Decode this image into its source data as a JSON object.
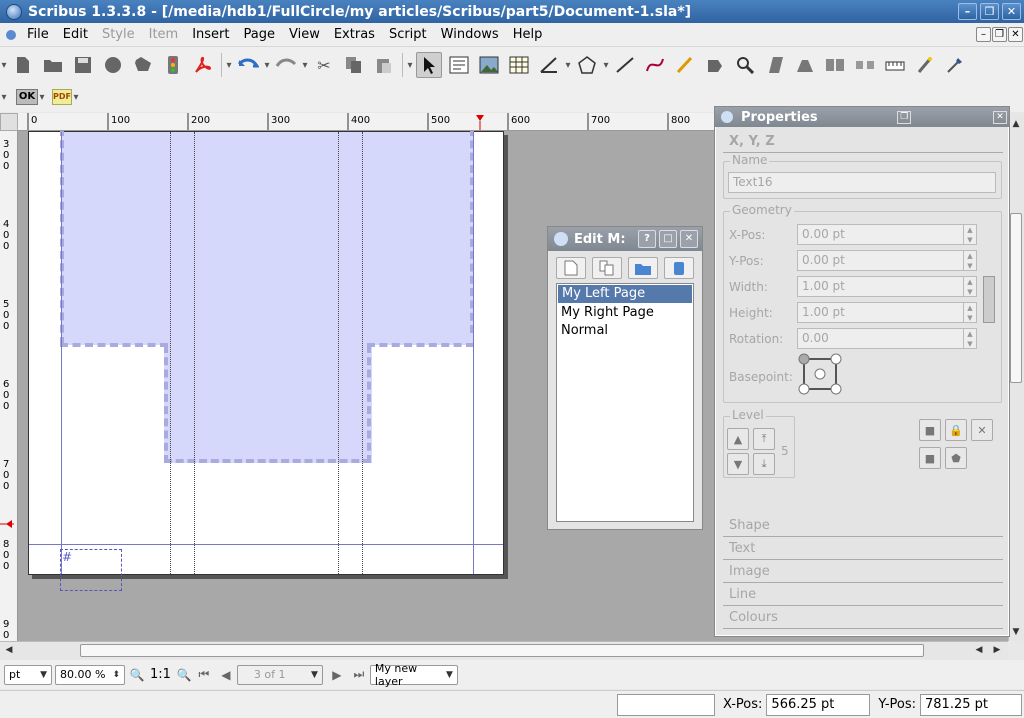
{
  "window": {
    "title": "Scribus 1.3.3.8 - [/media/hdb1/FullCircle/my articles/Scribus/part5/Document-1.sla*]",
    "btn_min": "–",
    "btn_max": "❐",
    "btn_close": "✕"
  },
  "menu": {
    "items": [
      "File",
      "Edit",
      "Style",
      "Item",
      "Insert",
      "Page",
      "View",
      "Extras",
      "Script",
      "Windows",
      "Help"
    ],
    "dim": [
      false,
      false,
      true,
      true,
      false,
      false,
      false,
      false,
      false,
      false,
      false
    ]
  },
  "toolbar2": {
    "ok_label": "OK",
    "pdf_label": "PDF"
  },
  "ruler": {
    "h_ticks": [
      "0",
      "100",
      "200",
      "300",
      "400",
      "500",
      "600",
      "700",
      "800"
    ],
    "v_ticks": [
      "300",
      "400",
      "500",
      "600",
      "700",
      "800",
      "900"
    ]
  },
  "canvas": {
    "text_frame_glyph": "#"
  },
  "edit_masters": {
    "title": "Edit M:",
    "help": "?",
    "max": "□",
    "close": "✕",
    "items": [
      "My Left Page",
      "My Right Page",
      "Normal"
    ],
    "selected": 0
  },
  "properties": {
    "title": "Properties",
    "xyz_tab": "X, Y, Z",
    "name_label": "Name",
    "name_value": "Text16",
    "geometry_label": "Geometry",
    "xpos_label": "X-Pos:",
    "xpos_value": "0.00 pt",
    "ypos_label": "Y-Pos:",
    "ypos_value": "0.00 pt",
    "width_label": "Width:",
    "width_value": "1.00 pt",
    "height_label": "Height:",
    "height_value": "1.00 pt",
    "rotation_label": "Rotation:",
    "rotation_value": "0.00",
    "basepoint_label": "Basepoint:",
    "level_label": "Level",
    "level_value": "5",
    "tabs": [
      "Shape",
      "Text",
      "Image",
      "Line",
      "Colours"
    ]
  },
  "bottom": {
    "unit": "pt",
    "zoom": "80.00 %",
    "ratio": "1:1",
    "page": "3 of 1",
    "layer": "My new layer"
  },
  "status": {
    "xpos_label": "X-Pos:",
    "xpos_value": "566.25 pt",
    "ypos_label": "Y-Pos:",
    "ypos_value": "781.25 pt"
  }
}
